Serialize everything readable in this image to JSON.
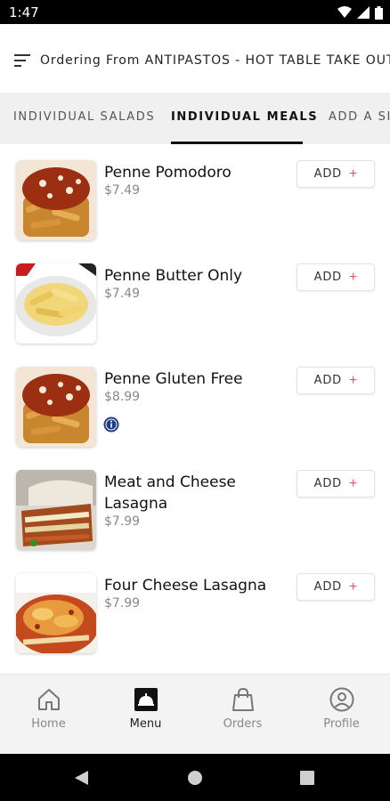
{
  "status_bar": {
    "time": "1:47"
  },
  "header": {
    "title": "Ordering From ANTIPASTOS - HOT TABLE TAKE OUT"
  },
  "tabs": [
    {
      "label": "INDIVIDUAL SALADS",
      "active": false
    },
    {
      "label": "INDIVIDUAL MEALS",
      "active": true
    },
    {
      "label": "ADD A SIDE",
      "active": false
    }
  ],
  "menu_items": [
    {
      "name": "Penne Pomodoro",
      "price": "$7.49",
      "image": "penne-pomodoro"
    },
    {
      "name": "Penne Butter Only",
      "price": "$7.49",
      "image": "penne-butter"
    },
    {
      "name": "Penne Gluten Free",
      "price": "$8.99",
      "image": "penne-gluten-free",
      "info_badge": true
    },
    {
      "name": "Meat and Cheese Lasagna",
      "price": "$7.99",
      "image": "meat-cheese-lasagna"
    },
    {
      "name": "Four Cheese Lasagna",
      "price": "$7.99",
      "image": "four-cheese-lasagna"
    }
  ],
  "add_button": {
    "label": "ADD",
    "icon": "plus-icon"
  },
  "bottom_nav": [
    {
      "label": "Home",
      "icon": "home-icon",
      "active": false
    },
    {
      "label": "Menu",
      "icon": "menu-cloche-icon",
      "active": true
    },
    {
      "label": "Orders",
      "icon": "shopping-bag-icon",
      "active": false
    },
    {
      "label": "Profile",
      "icon": "profile-icon",
      "active": false
    }
  ],
  "colors": {
    "accent": "#e05a5a",
    "tab_bar_bg": "#f0f0f0",
    "nav_bg": "#f3f3f3",
    "info_badge": "#1f3a8a"
  }
}
